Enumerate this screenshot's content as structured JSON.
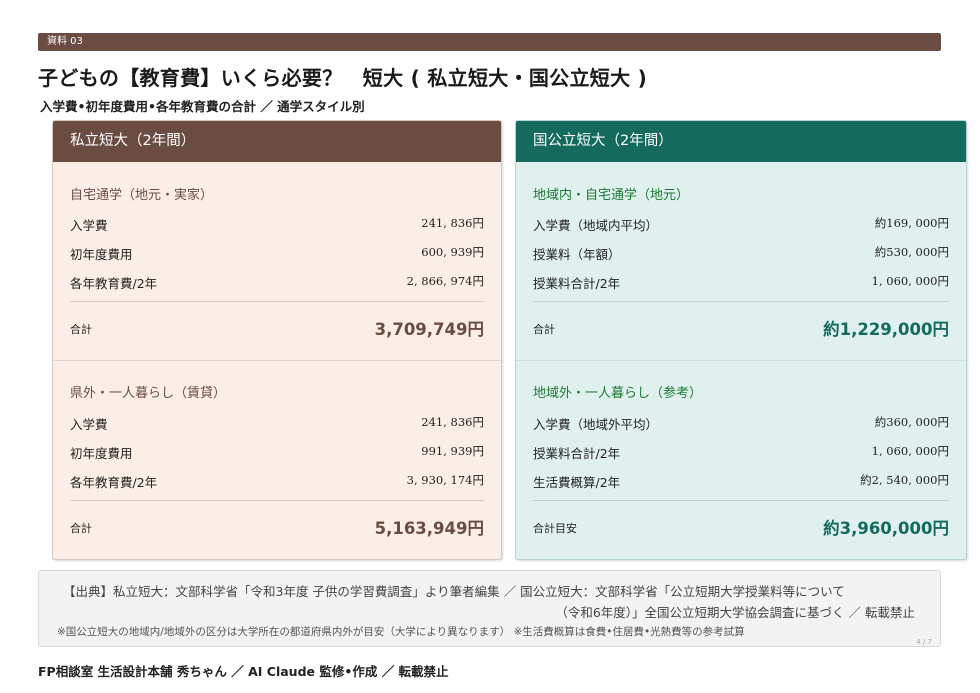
{
  "header": {
    "tag": "資料 03",
    "title": "子どもの【教育費】いくら必要？　短大 ( 私立短大・国公立短大 )",
    "subtitle": "入学費•初年度費用•各年教育費の合計 ／ 通学スタイル別"
  },
  "private": {
    "heading": "私立短大（2年間）",
    "home": {
      "title": "自宅通学（地元・実家）",
      "rows": [
        {
          "label": "入学費",
          "value": "241, 836円"
        },
        {
          "label": "初年度費用",
          "value": "600, 939円"
        },
        {
          "label": "各年教育費/2年",
          "value": "2, 866, 974円"
        }
      ],
      "total_label": "合計",
      "total_value": "3,709,749円"
    },
    "away": {
      "title": "県外・一人暮らし（賃貸）",
      "rows": [
        {
          "label": "入学費",
          "value": "241, 836円"
        },
        {
          "label": "初年度費用",
          "value": "991, 939円"
        },
        {
          "label": "各年教育費/2年",
          "value": "3, 930, 174円"
        }
      ],
      "total_label": "合計",
      "total_value": "5,163,949円"
    }
  },
  "public": {
    "heading": "国公立短大（2年間）",
    "home": {
      "title": "地域内・自宅通学（地元）",
      "rows": [
        {
          "label": "入学費（地域内平均）",
          "value": "約169, 000円"
        },
        {
          "label": "授業料（年額）",
          "value": "約530, 000円"
        },
        {
          "label": "授業料合計/2年",
          "value": "1, 060, 000円"
        }
      ],
      "total_label": "合計",
      "total_value": "約1,229,000円"
    },
    "away": {
      "title": "地域外・一人暮らし（参考）",
      "rows": [
        {
          "label": "入学費（地域外平均）",
          "value": "約360, 000円"
        },
        {
          "label": "授業料合計/2年",
          "value": "1, 060, 000円"
        },
        {
          "label": "生活費概算/2年",
          "value": "約2, 540, 000円"
        }
      ],
      "total_label": "合計目安",
      "total_value": "約3,960,000円"
    }
  },
  "source": {
    "line1": "【出典】私立短大：文部科学省「令和3年度 子供の学習費調査」より筆者編集 ／ 国公立短大：文部科学省「公立短期大学授業料等について",
    "line2": "（令和6年度）」全国公立短期大学協会調査に基づく ／ 転載禁止",
    "note": "※国公立短大の地域内/地域外の区分は大学所在の都道府県内外が目安（大学により異なります） ※生活費概算は食費•住居費•光熱費等の参考試算",
    "page": "4 / 7"
  },
  "footer": "FP相談室 生活設計本舗 秀ちゃん ／ AI Claude 監修•作成 ／ 転載禁止"
}
